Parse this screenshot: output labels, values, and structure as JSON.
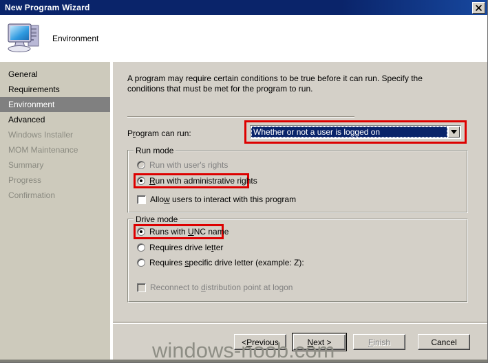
{
  "window": {
    "title": "New Program Wizard",
    "close_icon": "close-icon",
    "accent_titlebar": "#0a246a",
    "surface": "#d4d0c8",
    "highlight_red": "#dd0000"
  },
  "header": {
    "title": "Environment",
    "icon": "computer-icon"
  },
  "sidebar": {
    "items": [
      {
        "label": "General",
        "state": "normal"
      },
      {
        "label": "Requirements",
        "state": "normal"
      },
      {
        "label": "Environment",
        "state": "selected"
      },
      {
        "label": "Advanced",
        "state": "normal"
      },
      {
        "label": "Windows Installer",
        "state": "disabled"
      },
      {
        "label": "MOM Maintenance",
        "state": "disabled"
      },
      {
        "label": "Summary",
        "state": "disabled"
      },
      {
        "label": "Progress",
        "state": "disabled"
      },
      {
        "label": "Confirmation",
        "state": "disabled"
      }
    ]
  },
  "main": {
    "description": "A program may require certain conditions to be true before it can run. Specify the conditions that must be met for the program to run.",
    "program_can_run": {
      "label": "Program can run:",
      "selected_value": "Whether or not a user is logged on",
      "dropdown_icon": "chevron-down-icon",
      "highlighted": true
    },
    "run_mode": {
      "title": "Run mode",
      "options": [
        {
          "label": "Run with user's rights",
          "checked": false,
          "disabled": true,
          "highlighted": false
        },
        {
          "label": "Run with administrative rights",
          "checked": true,
          "disabled": false,
          "highlighted": true
        }
      ],
      "checkbox": {
        "label": "Allow users to interact with this program",
        "checked": false,
        "disabled": false
      }
    },
    "drive_mode": {
      "title": "Drive mode",
      "options": [
        {
          "label": "Runs with UNC name",
          "checked": true,
          "disabled": false,
          "highlighted": true
        },
        {
          "label": "Requires drive letter",
          "checked": false,
          "disabled": false,
          "highlighted": false
        },
        {
          "label": "Requires specific drive letter (example: Z):",
          "checked": false,
          "disabled": false,
          "highlighted": false
        }
      ],
      "checkbox": {
        "label": "Reconnect to distribution point at logon",
        "checked": false,
        "disabled": true
      }
    }
  },
  "footer": {
    "buttons": [
      {
        "label": "< Previous",
        "state": "normal"
      },
      {
        "label": "Next >",
        "state": "default"
      },
      {
        "label": "Finish",
        "state": "disabled"
      },
      {
        "label": "Cancel",
        "state": "normal"
      }
    ]
  },
  "watermark": {
    "text": "windows-noob.com"
  }
}
